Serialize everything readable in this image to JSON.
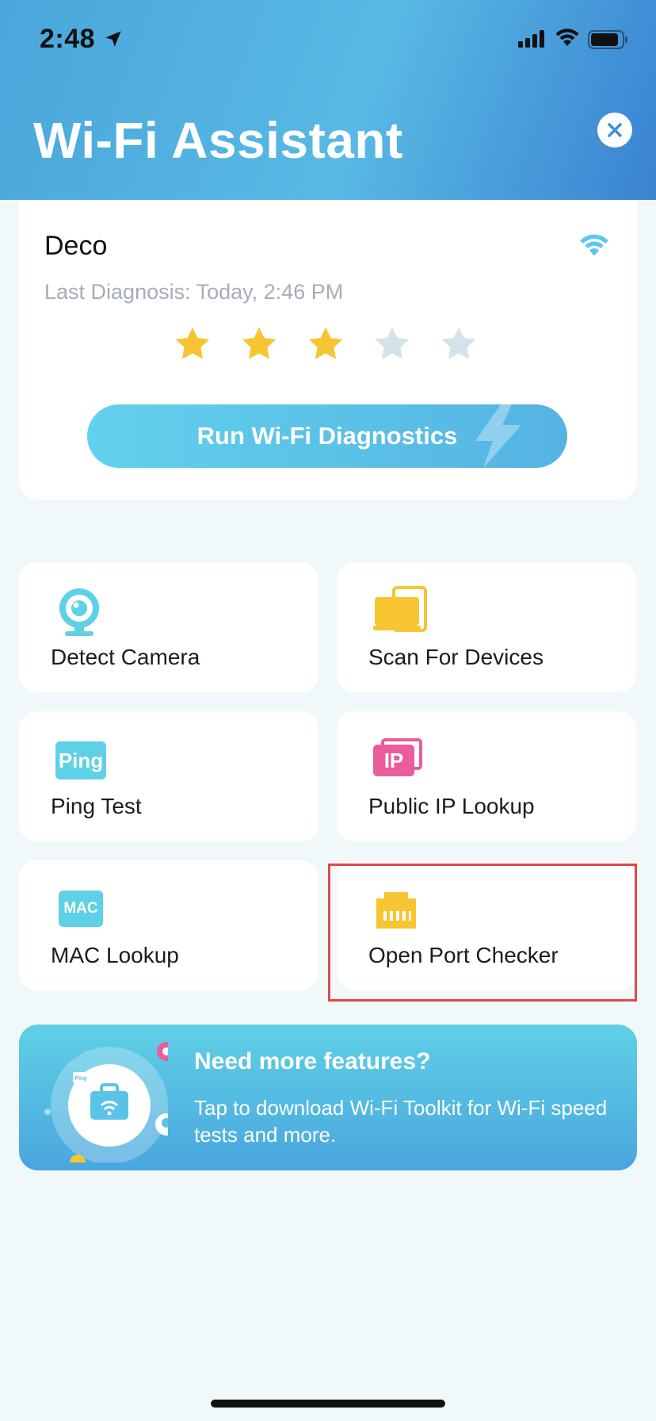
{
  "status_bar": {
    "time": "2:48"
  },
  "header": {
    "title": "Wi-Fi Assistant"
  },
  "card": {
    "title": "Deco",
    "last_diagnosis": "Last Diagnosis: Today, 2:46 PM",
    "rating": 3,
    "rating_max": 5,
    "button_label": "Run Wi-Fi Diagnostics"
  },
  "tiles": [
    {
      "label": "Detect Camera",
      "icon": "camera-icon"
    },
    {
      "label": "Scan For Devices",
      "icon": "devices-icon"
    },
    {
      "label": "Ping Test",
      "icon": "ping-icon",
      "icon_text": "Ping"
    },
    {
      "label": "Public IP Lookup",
      "icon": "ip-icon",
      "icon_text": "IP"
    },
    {
      "label": "MAC Lookup",
      "icon": "mac-icon",
      "icon_text": "MAC"
    },
    {
      "label": "Open Port Checker",
      "icon": "ethernet-port-icon"
    }
  ],
  "promo": {
    "title": "Need more features?",
    "text": "Tap to download Wi-Fi Toolkit for Wi-Fi speed tests and more.",
    "art_label": "Ping"
  },
  "colors": {
    "accent": "#58b9e4",
    "star_filled": "#f7c531",
    "star_empty": "#d3e3ea",
    "camera": "#5fd0e6",
    "devices": "#f7c531",
    "ping": "#5fd0e6",
    "ip": "#ea5c9c",
    "mac": "#5fd0e6",
    "port": "#f7c531",
    "highlight": "#e04848"
  }
}
